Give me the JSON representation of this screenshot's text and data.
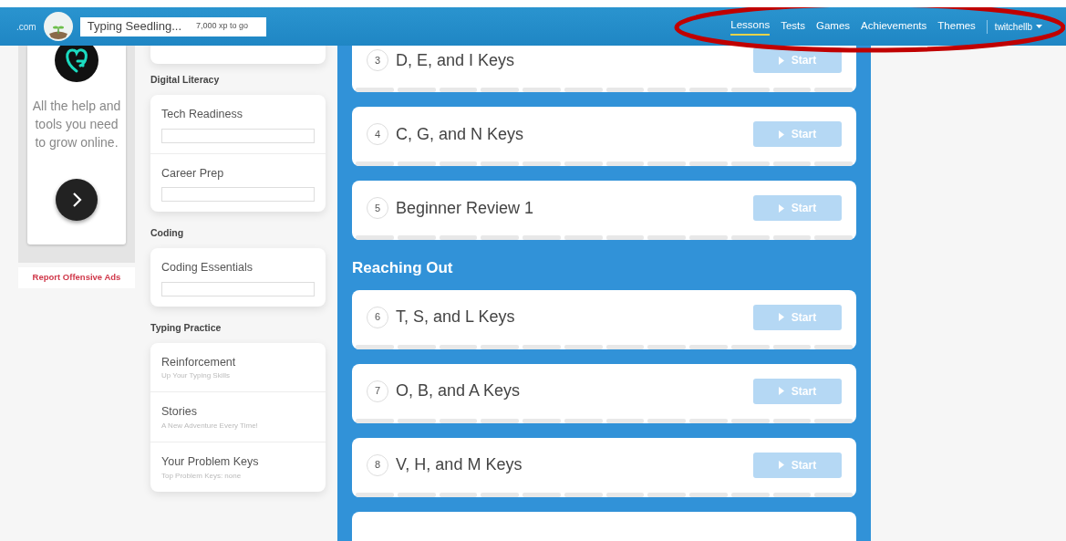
{
  "header": {
    "brand_suffix": ".com",
    "rank": "Typing Seedling...",
    "xp": "7,000 xp to go",
    "nav": [
      {
        "label": "Lessons",
        "selected": true
      },
      {
        "label": "Tests",
        "selected": false
      },
      {
        "label": "Games",
        "selected": false
      },
      {
        "label": "Achievements",
        "selected": false
      },
      {
        "label": "Themes",
        "selected": false
      }
    ],
    "user": "twitchellb"
  },
  "ad": {
    "text": "All the help and tools you need to grow online.",
    "report": "Report Offensive Ads"
  },
  "courses": [
    {
      "heading": "Digital Literacy",
      "items": [
        {
          "kind": "progress",
          "title": "Tech Readiness"
        },
        {
          "kind": "progress",
          "title": "Career Prep"
        }
      ]
    },
    {
      "heading": "Coding",
      "items": [
        {
          "kind": "progress",
          "title": "Coding Essentials"
        }
      ]
    },
    {
      "heading": "Typing Practice",
      "items": [
        {
          "kind": "subtitle",
          "title": "Reinforcement",
          "subtitle": "Up Your Typing Skills"
        },
        {
          "kind": "subtitle",
          "title": "Stories",
          "subtitle": "A New Adventure Every Time!"
        },
        {
          "kind": "subtitle",
          "title": "Your Problem Keys",
          "subtitle": "Top Problem Keys: none"
        }
      ]
    }
  ],
  "lesson_sections": [
    {
      "lessons": [
        {
          "number": "3",
          "title": "D, E, and I Keys",
          "button": "Start"
        },
        {
          "number": "4",
          "title": "C, G, and N Keys",
          "button": "Start"
        },
        {
          "number": "5",
          "title": "Beginner Review 1",
          "button": "Start"
        }
      ]
    },
    {
      "heading": "Reaching Out",
      "lessons": [
        {
          "number": "6",
          "title": "T, S, and L Keys",
          "button": "Start"
        },
        {
          "number": "7",
          "title": "O, B, and A Keys",
          "button": "Start"
        },
        {
          "number": "8",
          "title": "V, H, and M Keys",
          "button": "Start"
        }
      ]
    }
  ],
  "annotation": {
    "kind": "ellipse"
  }
}
